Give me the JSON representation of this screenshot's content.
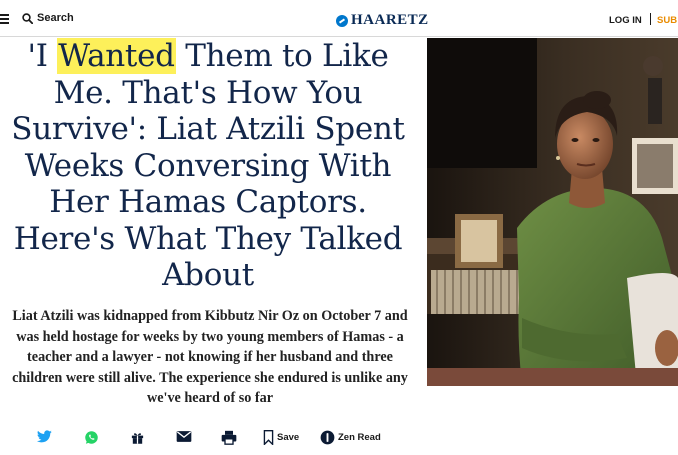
{
  "header": {
    "search_label": "Search",
    "logo_text": "HAARETZ",
    "login_label": "LOG IN",
    "subscribe_label": "SUB"
  },
  "article": {
    "headline_before": "'I ",
    "headline_highlight": "Wanted",
    "headline_after": " Them to Like Me. That's How You Survive': Liat Atzili Spent Weeks Conversing With Her Hamas Captors. Here's What They Talked About",
    "deck": "Liat Atzili was kidnapped from Kibbutz Nir Oz on October 7 and was held hostage for weeks by two young members of Hamas - a teacher and a lawyer - not knowing if her husband and three children were still alive. The experience she endured is unlike any we've heard of so far"
  },
  "share_bar": {
    "save_label": "Save",
    "zen_label": "Zen Read",
    "icons": [
      "twitter-icon",
      "whatsapp-icon",
      "gift-icon",
      "email-icon",
      "print-icon",
      "bookmark-icon",
      "zen-read-icon"
    ]
  },
  "colors": {
    "highlight": "#fdf05a",
    "subscribe": "#e98b00",
    "logo_mark": "#0077cc",
    "twitter": "#1da1f2",
    "whatsapp": "#25d366"
  }
}
